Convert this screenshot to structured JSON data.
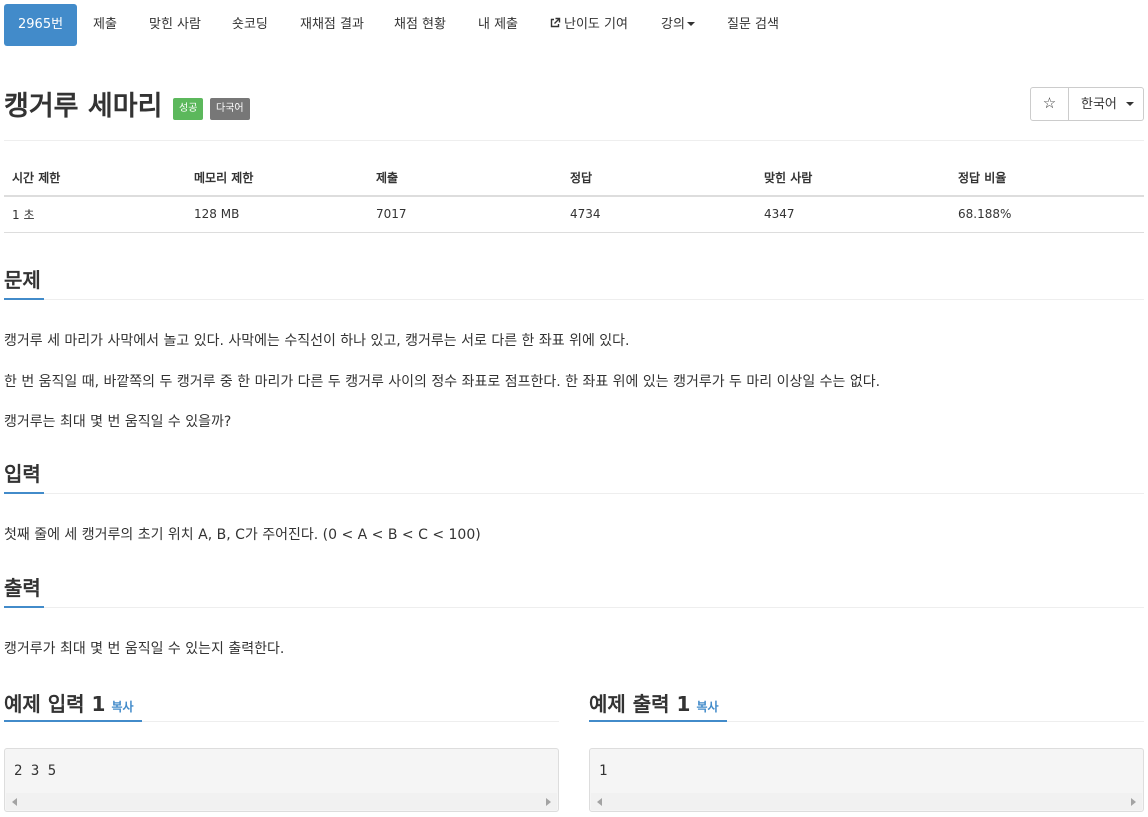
{
  "nav": {
    "items": [
      {
        "label": "2965번",
        "active": true
      },
      {
        "label": "제출"
      },
      {
        "label": "맞힌 사람"
      },
      {
        "label": "숏코딩"
      },
      {
        "label": "재채점 결과"
      },
      {
        "label": "채점 현황"
      },
      {
        "label": "내 제출"
      },
      {
        "label": "난이도 기여",
        "icon": "external-link-icon"
      },
      {
        "label": "강의",
        "icon": "caret-down-icon"
      },
      {
        "label": "질문 검색"
      }
    ]
  },
  "problem": {
    "title": "캥거루 세마리",
    "badges": [
      "성공",
      "다국어"
    ],
    "star_icon": "☆",
    "language": "한국어"
  },
  "info_table": {
    "headers": [
      "시간 제한",
      "메모리 제한",
      "제출",
      "정답",
      "맞힌 사람",
      "정답 비율"
    ],
    "row": [
      "1 초",
      "128 MB",
      "7017",
      "4734",
      "4347",
      "68.188%"
    ]
  },
  "sections": {
    "problem": {
      "heading": "문제",
      "paragraphs": [
        "캥거루 세 마리가 사막에서 놀고 있다. 사막에는 수직선이 하나 있고, 캥거루는 서로 다른 한 좌표 위에 있다.",
        "한 번 움직일 때, 바깥쪽의 두 캥거루 중 한 마리가 다른 두 캥거루 사이의 정수 좌표로 점프한다. 한 좌표 위에 있는 캥거루가 두 마리 이상일 수는 없다.",
        "캥거루는 최대 몇 번 움직일 수 있을까?"
      ]
    },
    "input": {
      "heading": "입력",
      "paragraph": "첫째 줄에 세 캥거루의 초기 위치 A, B, C가 주어진다. (0 < A < B < C < 100)"
    },
    "output": {
      "heading": "출력",
      "paragraph": "캥거루가 최대 몇 번 움직일 수 있는지 출력한다."
    }
  },
  "samples": {
    "input": {
      "heading": "예제 입력 1",
      "copy_label": "복사",
      "content": "2 3 5"
    },
    "output": {
      "heading": "예제 출력 1",
      "copy_label": "복사",
      "content": "1"
    }
  },
  "colors": {
    "primary": "#428bca",
    "success": "#5cb85c",
    "default_badge": "#777777"
  }
}
